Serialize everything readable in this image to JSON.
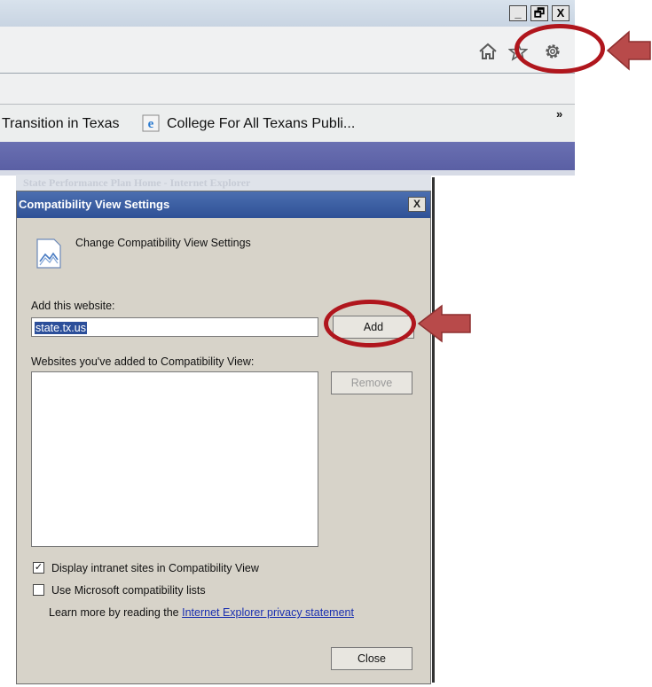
{
  "browser": {
    "window_buttons": [
      "_",
      "🗗",
      "X"
    ],
    "toolbar_icons": [
      "home-icon",
      "favorites-star-icon",
      "tools-gear-icon"
    ],
    "favorites": [
      {
        "label": "Transition in Texas",
        "icon": "none"
      },
      {
        "label": "College For All Texans Publi...",
        "icon": "ie-page-icon"
      }
    ],
    "overflow": "»"
  },
  "dialog": {
    "behind_title": "State Performance Plan Home - Internet Explorer",
    "title": "Compatibility View Settings",
    "close": "X",
    "header_text": "Change Compatibility View Settings",
    "add_label": "Add this website:",
    "site_value": "state.tx.us",
    "add_button": "Add",
    "list_label": "Websites you've added to Compatibility View:",
    "remove_button": "Remove",
    "checkbox_intranet": {
      "label": "Display intranet sites in Compatibility View",
      "checked": true
    },
    "checkbox_ms_lists": {
      "label": "Use Microsoft compatibility lists",
      "checked": false
    },
    "privacy_text": "Learn more by reading the",
    "privacy_link": "Internet Explorer privacy statement",
    "close_button": "Close"
  },
  "colors": {
    "highlight": "#b0161d",
    "arrow": "#b84a4a",
    "dialog_title": "#2f5196"
  }
}
